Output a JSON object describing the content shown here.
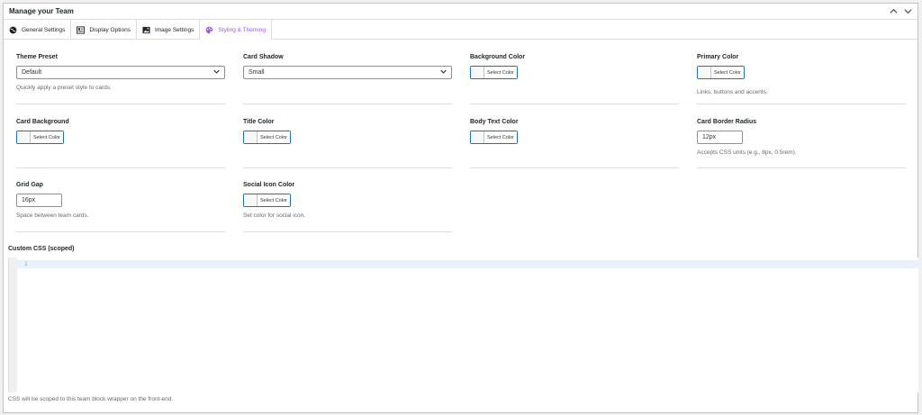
{
  "panel": {
    "title": "Manage your Team"
  },
  "tabs": [
    {
      "label": "General Settings",
      "icon": "globe-icon"
    },
    {
      "label": "Display Options",
      "icon": "layout-icon"
    },
    {
      "label": "Image Settings",
      "icon": "image-icon"
    },
    {
      "label": "Styling & Theming",
      "icon": "palette-icon",
      "active": true
    }
  ],
  "fields": {
    "theme_preset": {
      "label": "Theme Preset",
      "value": "Default",
      "desc": "Quickly apply a preset style to cards."
    },
    "card_shadow": {
      "label": "Card Shadow",
      "value": "Small"
    },
    "background_color": {
      "label": "Background Color",
      "button": "Select Color"
    },
    "primary_color": {
      "label": "Primary Color",
      "button": "Select Color",
      "desc": "Links, buttons and accents."
    },
    "card_background": {
      "label": "Card Background",
      "button": "Select Color"
    },
    "title_color": {
      "label": "Title Color",
      "button": "Select Color"
    },
    "body_text_color": {
      "label": "Body Text Color",
      "button": "Select Color"
    },
    "card_border_radius": {
      "label": "Card Border Radius",
      "value": "12px",
      "desc": "Accepts CSS units (e.g., 8px, 0.5rem)."
    },
    "grid_gap": {
      "label": "Grid Gap",
      "value": "16px",
      "desc": "Space between team cards."
    },
    "social_icon_color": {
      "label": "Social Icon Color",
      "button": "Select Color",
      "desc": "Set color for social icon."
    }
  },
  "custom_css": {
    "label": "Custom CSS (scoped)",
    "line_number": "1",
    "desc": "CSS will be scoped to this team block wrapper on the front-end."
  },
  "colors": {
    "accent": "#9b5de5",
    "button_border": "#2271b1"
  }
}
